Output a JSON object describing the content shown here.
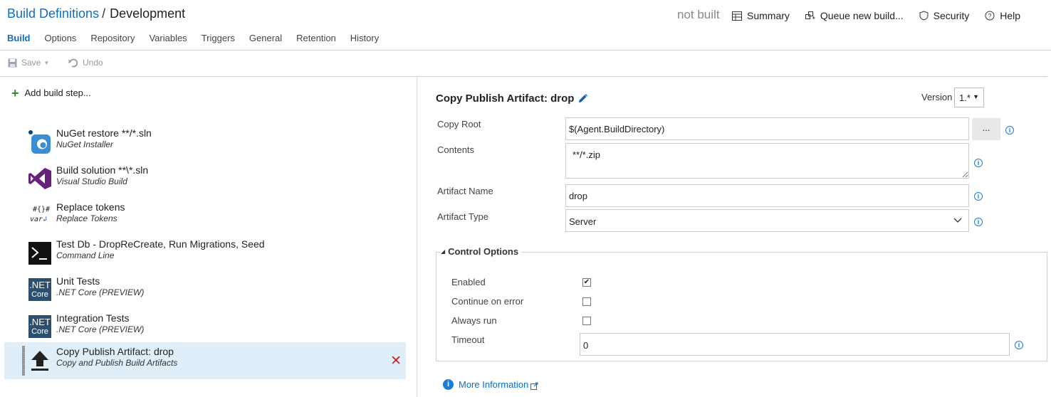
{
  "breadcrumb": {
    "parent": "Build Definitions",
    "separator": "/",
    "current": "Development"
  },
  "status": "not built",
  "header_actions": [
    {
      "label": "Summary",
      "icon": "table-icon"
    },
    {
      "label": "Queue new build...",
      "icon": "queue-icon"
    },
    {
      "label": "Security",
      "icon": "shield-icon"
    },
    {
      "label": "Help",
      "icon": "help-icon"
    }
  ],
  "tabs": [
    "Build",
    "Options",
    "Repository",
    "Variables",
    "Triggers",
    "General",
    "Retention",
    "History"
  ],
  "active_tab": "Build",
  "toolbar": {
    "save_label": "Save",
    "undo_label": "Undo"
  },
  "add_step_label": "Add build step...",
  "steps": [
    {
      "title": "NuGet restore **/*.sln",
      "subtitle": "NuGet Installer",
      "icon": "nuget-icon"
    },
    {
      "title": "Build solution **\\*.sln",
      "subtitle": "Visual Studio Build",
      "icon": "visual-studio-icon"
    },
    {
      "title": "Replace tokens",
      "subtitle": "Replace Tokens",
      "icon": "replace-tokens-icon"
    },
    {
      "title": "Test Db - DropReCreate, Run Migrations, Seed",
      "subtitle": "Command Line",
      "icon": "command-line-icon"
    },
    {
      "title": "Unit Tests",
      "subtitle": ".NET Core (PREVIEW)",
      "icon": "dotnet-core-icon"
    },
    {
      "title": "Integration Tests",
      "subtitle": ".NET Core (PREVIEW)",
      "icon": "dotnet-core-icon"
    },
    {
      "title": "Copy Publish Artifact: drop",
      "subtitle": "Copy and Publish Build Artifacts",
      "icon": "upload-icon",
      "selected": true
    }
  ],
  "dotnet_badge": {
    "line1": ".NET",
    "line2": "Core"
  },
  "replace_badge": {
    "line1": "#{}#",
    "line2": "var"
  },
  "detail": {
    "title": "Copy Publish Artifact: drop",
    "version_label": "Version",
    "version_value": "1.*",
    "fields": {
      "copy_root_label": "Copy Root",
      "copy_root_value": "$(Agent.BuildDirectory)",
      "browse_label": "...",
      "contents_label": "Contents",
      "contents_value": "**/*.zip",
      "artifact_name_label": "Artifact Name",
      "artifact_name_value": "drop",
      "artifact_type_label": "Artifact Type",
      "artifact_type_value": "Server"
    },
    "control_options": {
      "title": "Control Options",
      "enabled_label": "Enabled",
      "enabled": true,
      "continue_label": "Continue on error",
      "continue": false,
      "always_label": "Always run",
      "always": false,
      "timeout_label": "Timeout",
      "timeout_value": "0"
    },
    "more_info": "More Information"
  },
  "colors": {
    "accent": "#106ebe",
    "selected_bg": "#dfeef9",
    "delete": "#c62828",
    "add": "#2f8a2f"
  }
}
